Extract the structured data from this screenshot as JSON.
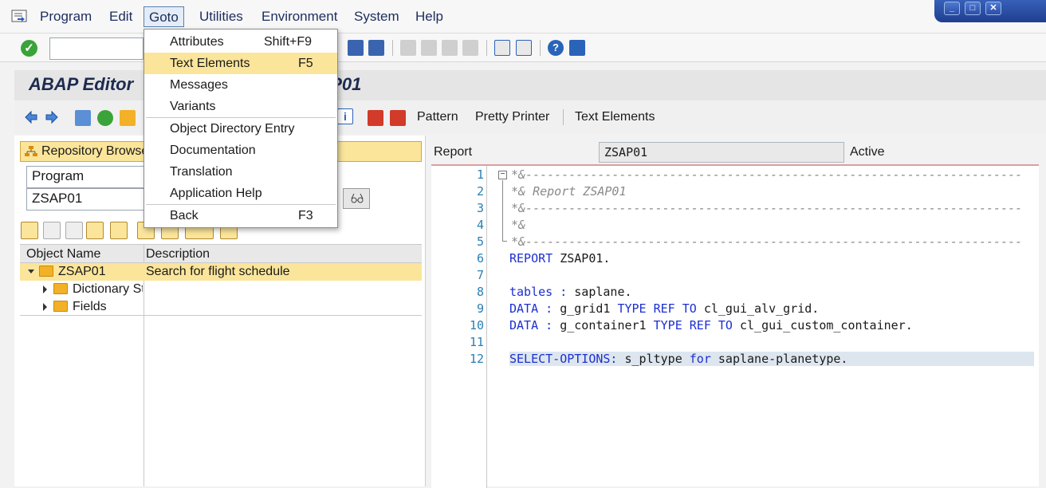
{
  "menubar": {
    "items": [
      "Program",
      "Edit",
      "Goto",
      "Utilities",
      "Environment",
      "System",
      "Help"
    ],
    "open_menu": "Goto"
  },
  "goto_menu": {
    "items": [
      {
        "label": "Attributes",
        "shortcut": "Shift+F9"
      },
      {
        "label": "Text Elements",
        "shortcut": "F5",
        "highlighted": true
      },
      {
        "label": "Messages",
        "shortcut": ""
      },
      {
        "label": "Variants",
        "shortcut": ""
      },
      {
        "label": "Object Directory Entry",
        "shortcut": ""
      },
      {
        "label": "Documentation",
        "shortcut": ""
      },
      {
        "label": "Translation",
        "shortcut": ""
      },
      {
        "label": "Application Help",
        "shortcut": ""
      },
      {
        "label": "Back",
        "shortcut": "F3"
      }
    ]
  },
  "header": {
    "title_left": "ABAP Editor",
    "title_right": "P01"
  },
  "app_toolbar": {
    "pattern": "Pattern",
    "pretty_printer": "Pretty Printer",
    "text_elements": "Text Elements"
  },
  "left_panel": {
    "repo_tab": "Repository Browse",
    "object_type": "Program",
    "object_name": "ZSAP01",
    "columns": [
      "Object Name",
      "Description"
    ],
    "tree": [
      {
        "name": "ZSAP01",
        "desc": "Search for flight schedule"
      },
      {
        "name": "Dictionary St",
        "desc": ""
      },
      {
        "name": "Fields",
        "desc": ""
      }
    ]
  },
  "editor": {
    "report_label": "Report",
    "report_value": "ZSAP01",
    "status": "Active",
    "line_numbers": [
      "1",
      "2",
      "3",
      "4",
      "5",
      "6",
      "7",
      "8",
      "9",
      "10",
      "11",
      "12"
    ],
    "lines": [
      "*&---------------------------------------------------------------------",
      "*& Report ZSAP01",
      "*&---------------------------------------------------------------------",
      "*&",
      "*&---------------------------------------------------------------------",
      "REPORT ZSAP01.",
      "",
      "tables : saplane.",
      "DATA : g_grid1 TYPE REF TO cl_gui_alv_grid.",
      "DATA : g_container1 TYPE REF TO cl_gui_custom_container.",
      "",
      "SELECT-OPTIONS: s_pltype for saplane-planetype."
    ]
  },
  "colors": {
    "accent_yellow": "#fbe59b",
    "keyword_blue": "#1c2fd1",
    "line_number_blue": "#2a7fb5"
  }
}
